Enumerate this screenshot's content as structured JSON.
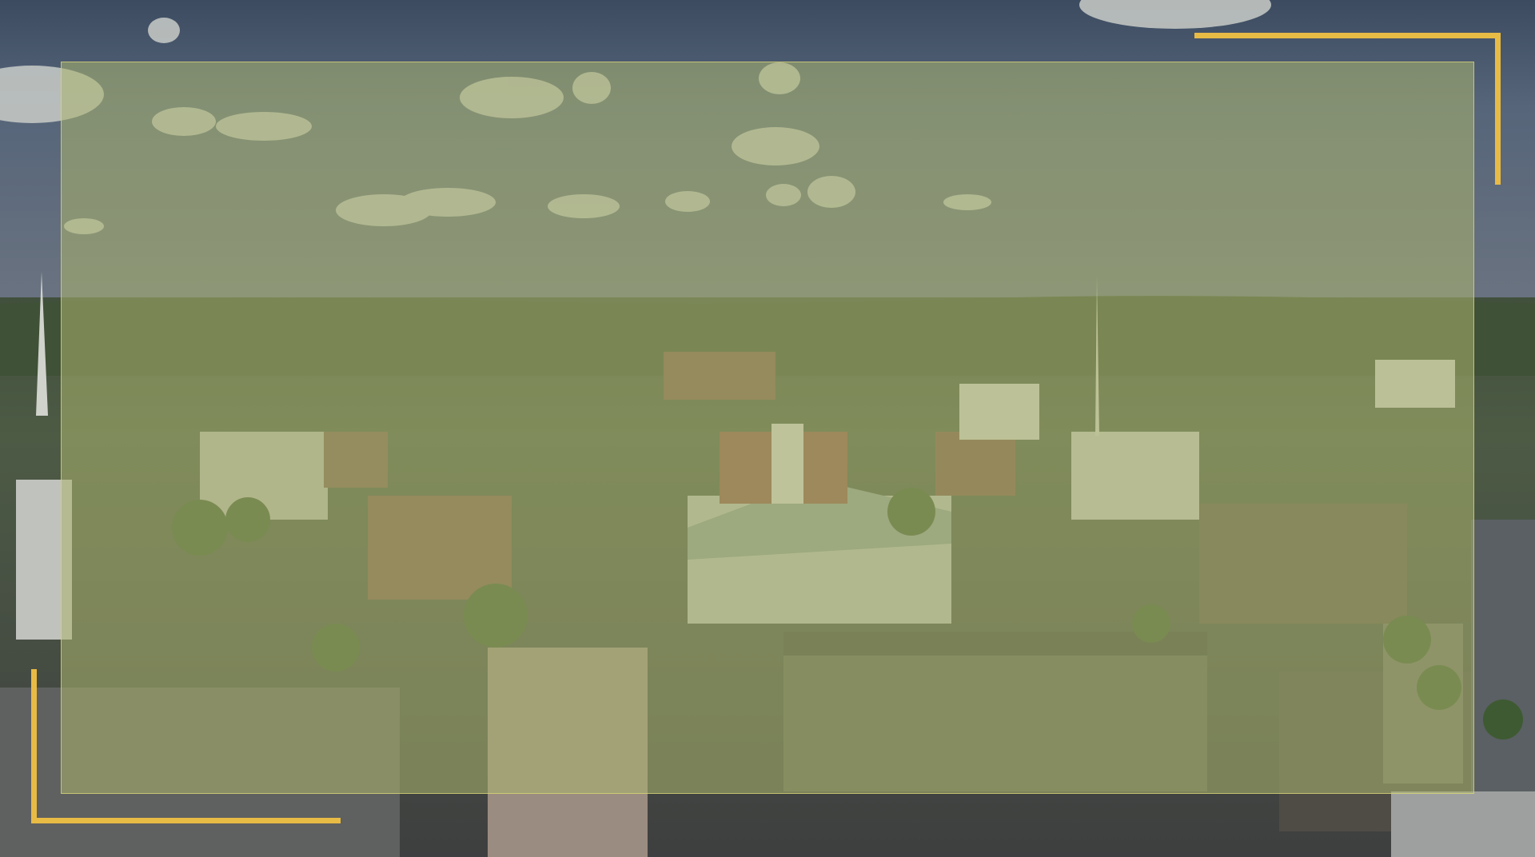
{
  "hero": {
    "image_alt": "",
    "accent_color": "#e8bb45",
    "overlay_color": "#acb46e"
  }
}
